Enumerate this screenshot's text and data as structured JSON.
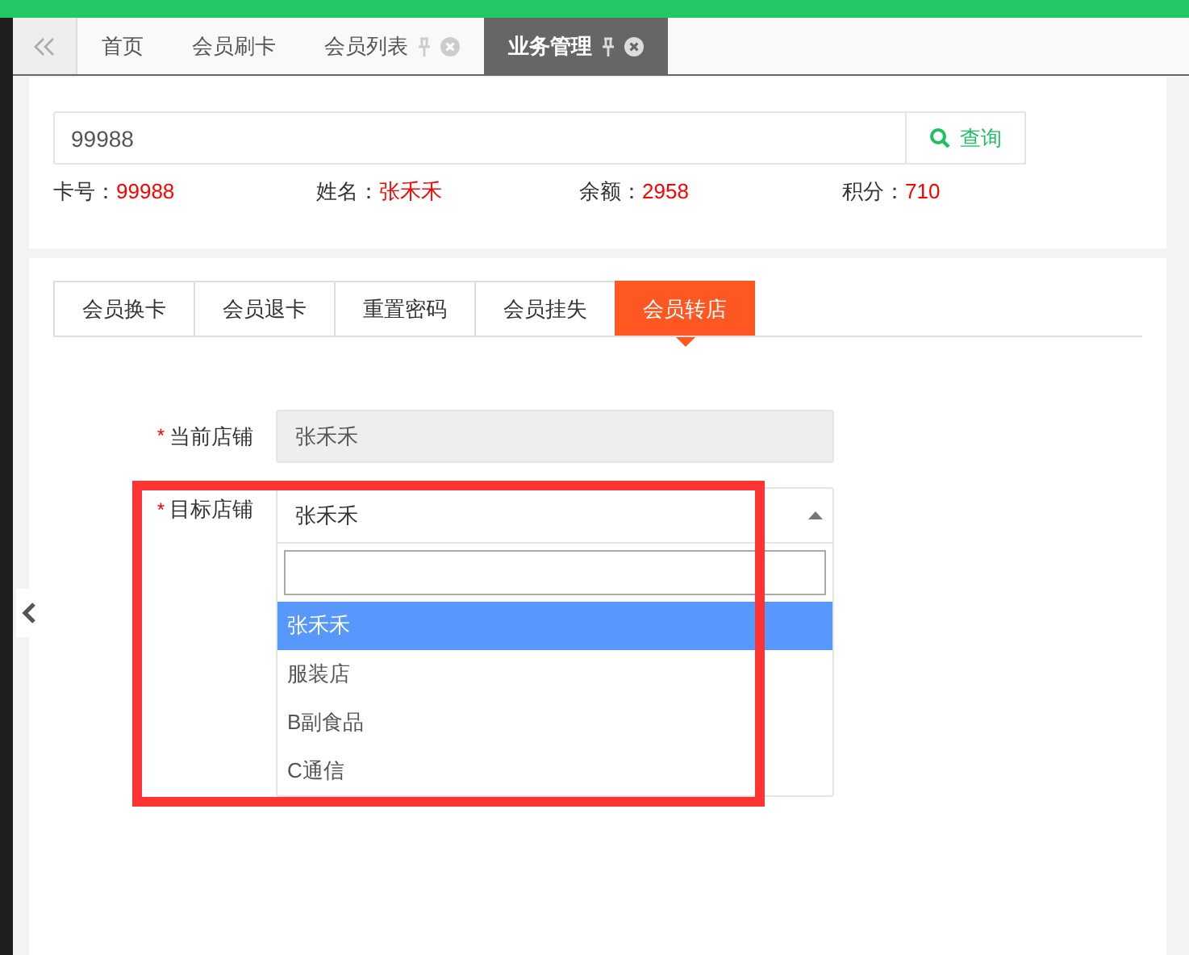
{
  "tabs": [
    {
      "label": "首页",
      "selected": false,
      "closable": false
    },
    {
      "label": "会员刷卡",
      "selected": false,
      "closable": false
    },
    {
      "label": "会员列表",
      "selected": false,
      "closable": true
    },
    {
      "label": "业务管理",
      "selected": true,
      "closable": true
    }
  ],
  "search": {
    "value": "99988",
    "button": "查询"
  },
  "member_info": [
    {
      "label": "卡号：",
      "value": "99988"
    },
    {
      "label": "姓名：",
      "value": "张禾禾"
    },
    {
      "label": "余额：",
      "value": "2958"
    },
    {
      "label": "积分：",
      "value": "710"
    }
  ],
  "business_tabs": [
    {
      "label": "会员换卡",
      "selected": false
    },
    {
      "label": "会员退卡",
      "selected": false
    },
    {
      "label": "重置密码",
      "selected": false
    },
    {
      "label": "会员挂失",
      "selected": false
    },
    {
      "label": "会员转店",
      "selected": true
    }
  ],
  "form": {
    "current_store": {
      "label": "当前店铺",
      "value": "张禾禾",
      "required_mark": "*",
      "disabled": true
    },
    "target_store": {
      "label": "目标店铺",
      "value": "张禾禾",
      "required_mark": "*",
      "expanded": true,
      "options": [
        {
          "label": "张禾禾",
          "selected": true
        },
        {
          "label": "服装店",
          "selected": false
        },
        {
          "label": "B副食品",
          "selected": false
        },
        {
          "label": "C通信",
          "selected": false
        }
      ]
    }
  }
}
